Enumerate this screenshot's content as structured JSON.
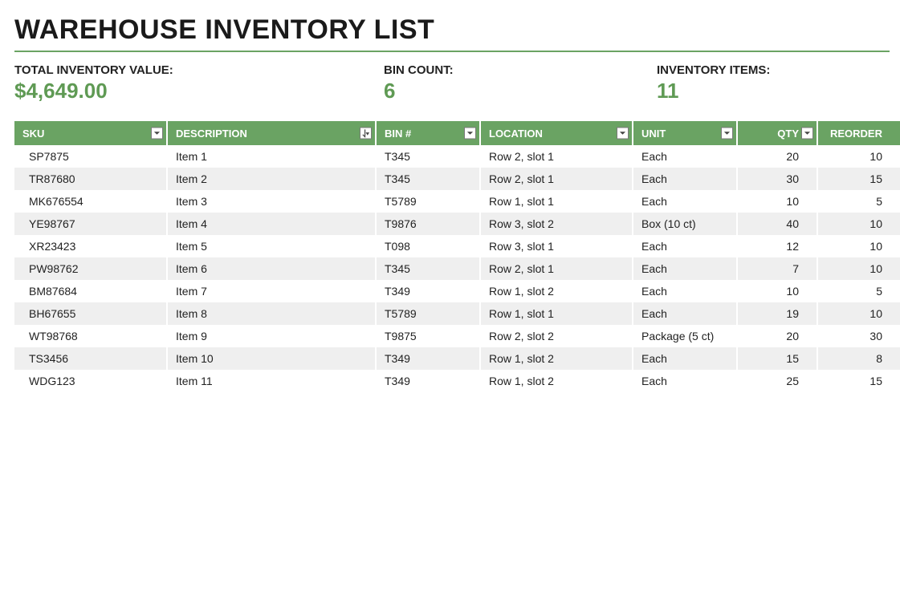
{
  "title": "WAREHOUSE INVENTORY LIST",
  "summary": {
    "total_label": "TOTAL INVENTORY VALUE:",
    "total_value": "$4,649.00",
    "bin_label": "BIN COUNT:",
    "bin_value": "6",
    "items_label": "INVENTORY ITEMS:",
    "items_value": "11"
  },
  "columns": {
    "sku": "SKU",
    "description": "DESCRIPTION",
    "bin": "BIN #",
    "location": "LOCATION",
    "unit": "UNIT",
    "qty": "QTY",
    "reorder": "REORDER"
  },
  "rows": [
    {
      "sku": "SP7875",
      "description": "Item 1",
      "bin": "T345",
      "location": "Row 2, slot 1",
      "unit": "Each",
      "qty": "20",
      "reorder": "10"
    },
    {
      "sku": "TR87680",
      "description": "Item 2",
      "bin": "T345",
      "location": "Row 2, slot 1",
      "unit": "Each",
      "qty": "30",
      "reorder": "15"
    },
    {
      "sku": "MK676554",
      "description": "Item 3",
      "bin": "T5789",
      "location": "Row 1, slot 1",
      "unit": "Each",
      "qty": "10",
      "reorder": "5"
    },
    {
      "sku": "YE98767",
      "description": "Item 4",
      "bin": "T9876",
      "location": "Row 3, slot 2",
      "unit": "Box (10 ct)",
      "qty": "40",
      "reorder": "10"
    },
    {
      "sku": "XR23423",
      "description": "Item 5",
      "bin": "T098",
      "location": "Row 3, slot 1",
      "unit": "Each",
      "qty": "12",
      "reorder": "10"
    },
    {
      "sku": "PW98762",
      "description": "Item 6",
      "bin": "T345",
      "location": "Row 2, slot 1",
      "unit": "Each",
      "qty": "7",
      "reorder": "10"
    },
    {
      "sku": "BM87684",
      "description": "Item 7",
      "bin": "T349",
      "location": "Row 1, slot 2",
      "unit": "Each",
      "qty": "10",
      "reorder": "5"
    },
    {
      "sku": "BH67655",
      "description": "Item 8",
      "bin": "T5789",
      "location": "Row 1, slot 1",
      "unit": "Each",
      "qty": "19",
      "reorder": "10"
    },
    {
      "sku": "WT98768",
      "description": "Item 9",
      "bin": "T9875",
      "location": "Row 2, slot 2",
      "unit": "Package (5 ct)",
      "qty": "20",
      "reorder": "30"
    },
    {
      "sku": "TS3456",
      "description": "Item 10",
      "bin": "T349",
      "location": "Row 1, slot 2",
      "unit": "Each",
      "qty": "15",
      "reorder": "8"
    },
    {
      "sku": "WDG123",
      "description": "Item 11",
      "bin": "T349",
      "location": "Row 1, slot 2",
      "unit": "Each",
      "qty": "25",
      "reorder": "15"
    }
  ]
}
